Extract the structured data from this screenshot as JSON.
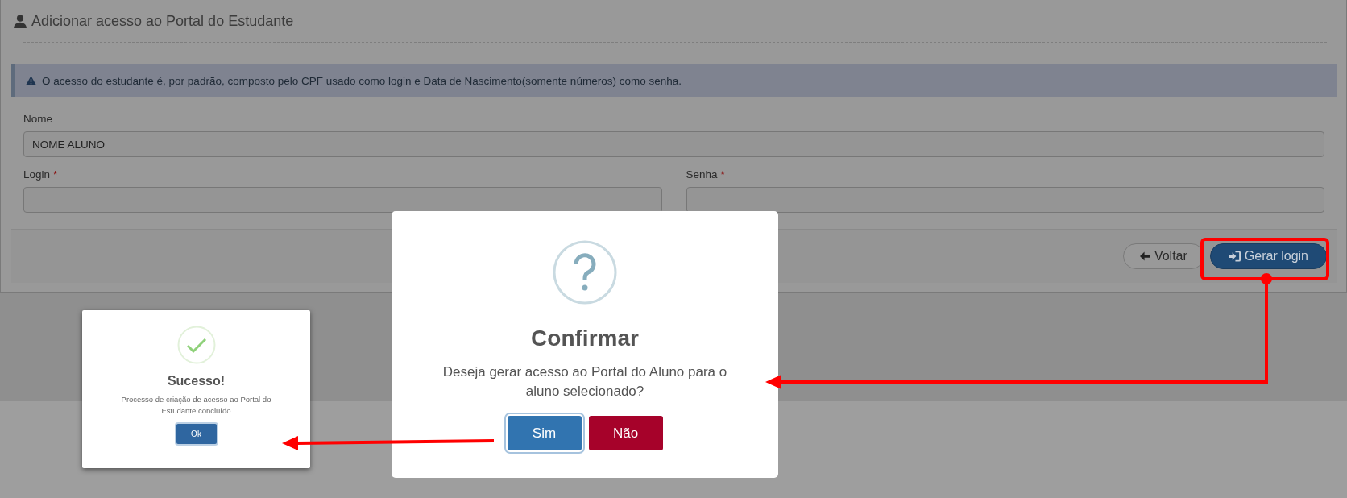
{
  "panel": {
    "title": "Adicionar acesso ao Portal do Estudante",
    "alert": "O acesso do estudante é, por padrão, composto pelo CPF usado como login e Data de Nascimento(somente números) como senha.",
    "fields": [
      {
        "label": "Nome",
        "value": "NOME ALUNO"
      },
      {
        "label": "Login",
        "required_mark": "*"
      },
      {
        "label": "Senha",
        "required_mark": "*"
      }
    ],
    "buttons": [
      {
        "label": "Voltar",
        "kind": "back"
      },
      {
        "label": "Gerar login",
        "kind": "primary"
      }
    ]
  },
  "confirm_dialog": {
    "title": "Confirmar",
    "message": "Deseja gerar acesso ao Portal do Aluno para o aluno selecionado?",
    "buttons": [
      {
        "label": "Sim",
        "kind": "confirm"
      },
      {
        "label": "Não",
        "kind": "cancel"
      }
    ]
  },
  "success_dialog": {
    "title": "Sucesso!",
    "message": "Processo de criação de acesso ao Portal do Estudante concluído",
    "button": "Ok"
  }
}
